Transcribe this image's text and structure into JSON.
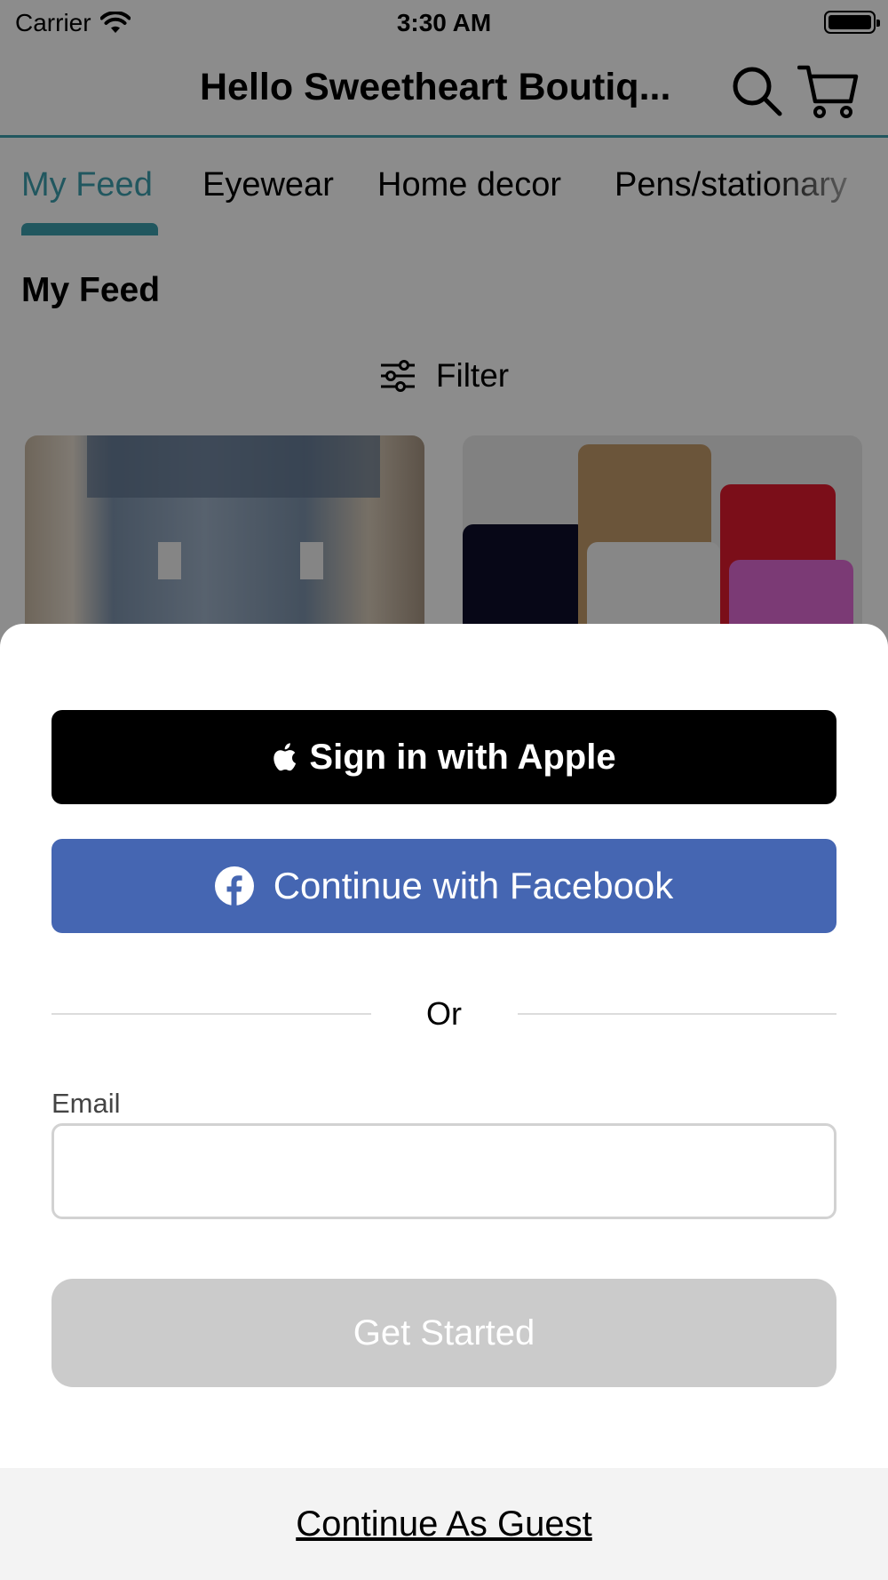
{
  "status_bar": {
    "carrier": "Carrier",
    "time": "3:30 AM",
    "wifi_icon": "wifi-icon",
    "battery_icon": "battery-icon"
  },
  "nav": {
    "title": "Hello Sweetheart Boutiq...",
    "search_icon": "search-icon",
    "cart_icon": "cart-icon",
    "accent_color": "#3d9fae"
  },
  "tabs": {
    "items": [
      {
        "label": "My Feed",
        "active": true
      },
      {
        "label": "Eyewear",
        "active": false
      },
      {
        "label": "Home decor",
        "active": false
      },
      {
        "label": "Pens/stationary",
        "active": false
      }
    ]
  },
  "feed": {
    "title": "My Feed",
    "filter_label": "Filter",
    "filter_icon": "sliders-icon"
  },
  "sheet": {
    "apple_button_label": "Sign in with Apple",
    "apple_icon": "apple-icon",
    "facebook_button_label": "Continue with Facebook",
    "facebook_icon": "facebook-icon",
    "facebook_color": "#4566b2",
    "or_label": "Or",
    "email_label": "Email",
    "email_value": "",
    "get_started_label": "Get Started",
    "get_started_enabled": false,
    "guest_label": "Continue As Guest"
  }
}
